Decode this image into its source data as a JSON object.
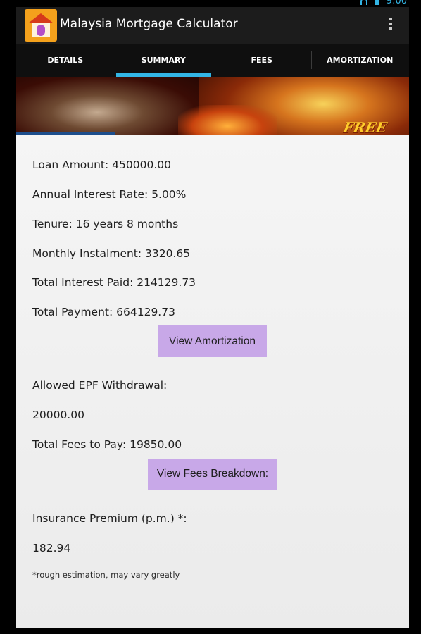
{
  "status": {
    "time": "9:00"
  },
  "app": {
    "title": "Malaysia Mortgage Calculator"
  },
  "tabs": [
    {
      "label": "DETAILS",
      "active": false
    },
    {
      "label": "SUMMARY",
      "active": true
    },
    {
      "label": "FEES",
      "active": false
    },
    {
      "label": "AMORTIZATION",
      "active": false
    }
  ],
  "banner": {
    "text": "FREE"
  },
  "summary": {
    "loan_amount": "Loan Amount: 450000.00",
    "interest_rate": "Annual Interest Rate: 5.00%",
    "tenure": "Tenure: 16 years 8 months",
    "monthly_instalment": "Monthly Instalment: 3320.65",
    "total_interest": "Total Interest Paid: 214129.73",
    "total_payment": "Total Payment: 664129.73",
    "view_amortization_label": "View Amortization",
    "epf_label": "Allowed EPF Withdrawal:",
    "epf_value": "20000.00",
    "total_fees": "Total Fees to Pay: 19850.00",
    "view_fees_label": "View Fees Breakdown:",
    "insurance_label": "Insurance Premium (p.m.) *:",
    "insurance_value": "182.94",
    "footnote": "*rough estimation, may vary greatly"
  },
  "colors": {
    "accent": "#33b5e5",
    "button": "#c8a8e8",
    "actionbar": "#1c1c1c"
  }
}
